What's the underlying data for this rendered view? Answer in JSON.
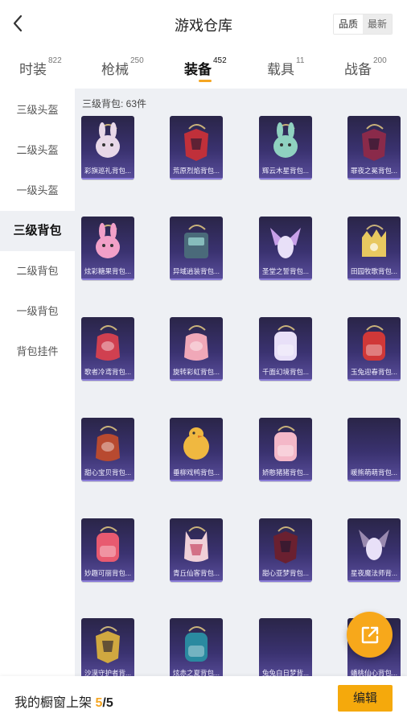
{
  "header": {
    "title": "游戏仓库",
    "sort_options": [
      "品质",
      "最新"
    ]
  },
  "tabs": [
    {
      "label": "时装",
      "count": "822"
    },
    {
      "label": "枪械",
      "count": "250"
    },
    {
      "label": "装备",
      "count": "452",
      "active": true
    },
    {
      "label": "载具",
      "count": "11"
    },
    {
      "label": "战备",
      "count": "200"
    }
  ],
  "sidebar": {
    "items": [
      {
        "label": "三级头盔"
      },
      {
        "label": "二级头盔"
      },
      {
        "label": "一级头盔"
      },
      {
        "label": "三级背包",
        "active": true
      },
      {
        "label": "二级背包"
      },
      {
        "label": "一级背包"
      },
      {
        "label": "背包挂件"
      }
    ]
  },
  "content": {
    "header": "三级背包: 63件",
    "items": [
      {
        "name": "彩旗巡礼背包...",
        "accent": "#e8d8e8",
        "pattern": "bunny"
      },
      {
        "name": "荒原烈焰背包...",
        "accent": "#c0303a",
        "pattern": "armor"
      },
      {
        "name": "辉云木星背包...",
        "accent": "#8fd1c0",
        "pattern": "bunny"
      },
      {
        "name": "罪夜之冕背包...",
        "accent": "#8a2a4a",
        "pattern": "armor"
      },
      {
        "name": "炫彩糖果背包...",
        "accent": "#f2a0c8",
        "pattern": "bunny"
      },
      {
        "name": "异域逍装背包...",
        "accent": "#4a6a7a",
        "pattern": "box"
      },
      {
        "name": "圣堂之誓背包...",
        "accent": "#c8a0e8",
        "pattern": "wings"
      },
      {
        "name": "田园牧歌背包...",
        "accent": "#e8c860",
        "pattern": "crown"
      },
      {
        "name": "歌者冷鸢背包...",
        "accent": "#d04050",
        "pattern": "bag"
      },
      {
        "name": "旋转彩虹背包...",
        "accent": "#f0a8b8",
        "pattern": "bag"
      },
      {
        "name": "千面幻境背包...",
        "accent": "#e8e0f8",
        "pattern": "backpack"
      },
      {
        "name": "玉兔迎春背包...",
        "accent": "#d03838",
        "pattern": "backpack"
      },
      {
        "name": "甜心宝贝背包...",
        "accent": "#b84a30",
        "pattern": "bag"
      },
      {
        "name": "垂柳戏鸭背包...",
        "accent": "#f0b840",
        "pattern": "duck"
      },
      {
        "name": "娇憨猪猪背包...",
        "accent": "#f4b8c8",
        "pattern": "backpack"
      },
      {
        "name": "暖熊萌萌背包...",
        "accent": "",
        "pattern": "empty"
      },
      {
        "name": "妙趣可丽背包...",
        "accent": "#e85a70",
        "pattern": "backpack"
      },
      {
        "name": "青丘仙客背包...",
        "accent": "#f0d0d8",
        "pattern": "fox"
      },
      {
        "name": "甜心亚梦背包...",
        "accent": "#6a2030",
        "pattern": "armor"
      },
      {
        "name": "星夜魔法师背...",
        "accent": "#9a8ab0",
        "pattern": "wings"
      },
      {
        "name": "沙漠守护者背...",
        "accent": "#d0a840",
        "pattern": "armor"
      },
      {
        "name": "炫赤之夏背包...",
        "accent": "#2a8aa0",
        "pattern": "backpack"
      },
      {
        "name": "兔兔白日梦背...",
        "accent": "",
        "pattern": "empty"
      },
      {
        "name": "蟠桃仙心背包...",
        "accent": "",
        "pattern": "empty"
      }
    ]
  },
  "bottom": {
    "label": "我的橱窗上架",
    "current": "5",
    "separator": "/",
    "total": "5",
    "edit_label": "编辑"
  },
  "colors": {
    "accent": "#f5a623",
    "card_bg_top": "#2a2548",
    "card_bg_bottom": "#5a4e9c",
    "panel_bg": "#eef0f4"
  }
}
